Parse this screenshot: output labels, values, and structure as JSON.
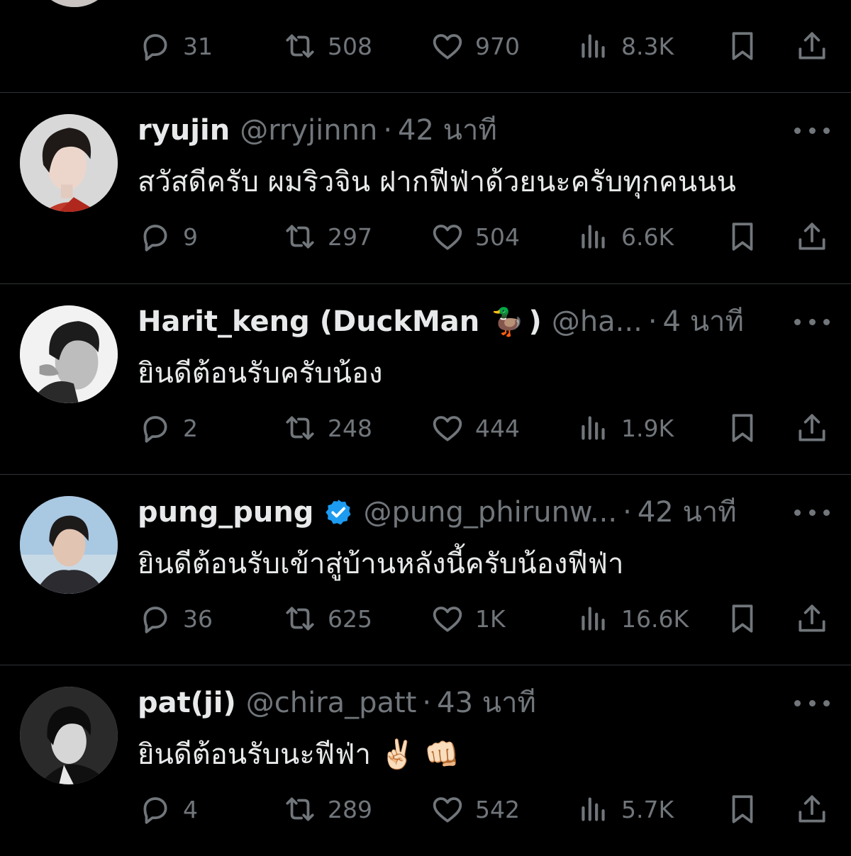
{
  "top_partial": {
    "reply_count": "31",
    "retweet_count": "508",
    "like_count": "970",
    "view_count": "8.3K"
  },
  "tweets": [
    {
      "display_name": "ryujin",
      "handle": "@rryjinnn",
      "separator": "·",
      "time": "42 นาที",
      "text": "สวัสดีครับ ผมริวจิน ฝากฟีฟ่าด้วยนะครับทุกคนนน",
      "reply_count": "9",
      "retweet_count": "297",
      "like_count": "504",
      "view_count": "6.6K"
    },
    {
      "display_name": "Harit_keng (DuckMan",
      "display_name_emoji": "🦆",
      "display_name_close": ")",
      "handle": "@ha...",
      "separator": "·",
      "time": "4 นาที",
      "text": "ยินดีต้อนรับครับน้อง",
      "reply_count": "2",
      "retweet_count": "248",
      "like_count": "444",
      "view_count": "1.9K"
    },
    {
      "display_name": "pung_pung",
      "verified": true,
      "handle": "@pung_phirunw...",
      "separator": "·",
      "time": "42 นาที",
      "text": "ยินดีต้อนรับเข้าสู่บ้านหลังนี้ครับน้องฟีฟ่า",
      "reply_count": "36",
      "retweet_count": "625",
      "like_count": "1K",
      "view_count": "16.6K"
    },
    {
      "display_name": "pat(ji)",
      "handle": "@chira_patt",
      "separator": "·",
      "time": "43 นาที",
      "text": "ยินดีต้อนรับนะฟีฟ่า ✌🏻 👊🏻",
      "reply_count": "4",
      "retweet_count": "289",
      "like_count": "542",
      "view_count": "5.7K"
    }
  ],
  "icons": {
    "reply": "reply-icon",
    "retweet": "retweet-icon",
    "like": "heart-icon",
    "views": "views-icon",
    "bookmark": "bookmark-icon",
    "share": "share-icon",
    "more": "more-icon",
    "verified": "verified-badge-icon"
  },
  "colors": {
    "background": "#000000",
    "text": "#e7e9ea",
    "secondary": "#71767b",
    "divider": "#2f3336",
    "verified": "#1d9bf0"
  }
}
